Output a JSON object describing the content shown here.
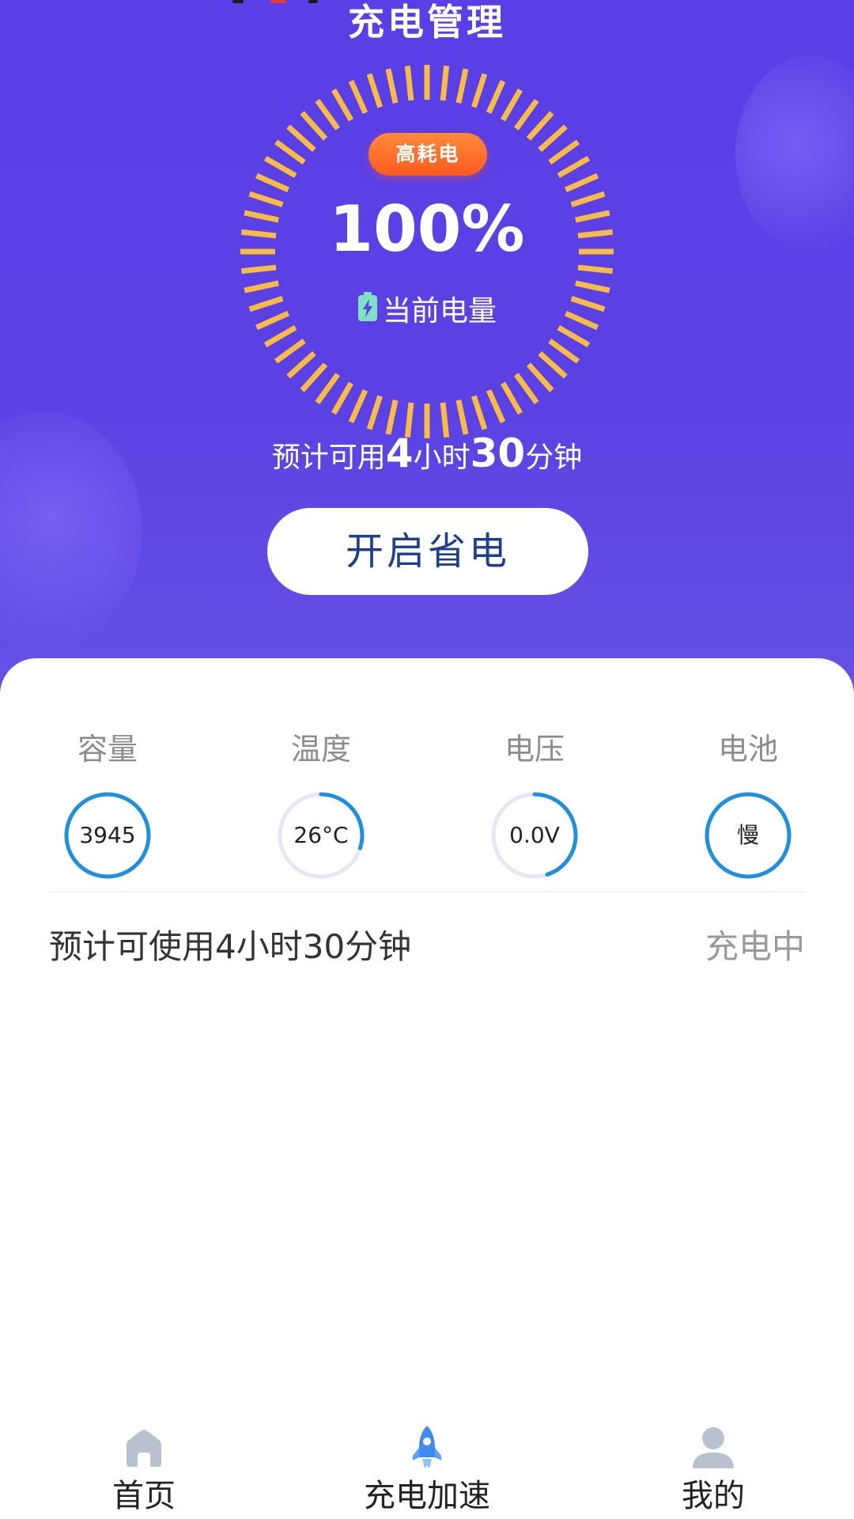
{
  "header": {
    "title": "充电管理"
  },
  "gauge": {
    "badge": "高耗电",
    "percent": "100%",
    "current_label": "当前电量",
    "level_fraction": 1.0
  },
  "estimate": {
    "prefix": "预计可用",
    "hours": "4",
    "hours_unit": "小时",
    "minutes": "30",
    "minutes_unit": "分钟"
  },
  "save_button": {
    "label": "开启省电"
  },
  "stats": [
    {
      "label": "容量",
      "value": "3945",
      "progress": 1.0
    },
    {
      "label": "温度",
      "value": "26°C",
      "progress": 0.3
    },
    {
      "label": "电压",
      "value": "0.0V",
      "progress": 0.45
    },
    {
      "label": "电池",
      "value": "慢",
      "progress": 1.0
    }
  ],
  "usage": {
    "text": "预计可使用4小时30分钟",
    "status": "充电中"
  },
  "nav": {
    "items": [
      {
        "label": "首页",
        "icon": "home-icon"
      },
      {
        "label": "充电加速",
        "icon": "rocket-icon"
      },
      {
        "label": "我的",
        "icon": "user-icon"
      }
    ]
  },
  "colors": {
    "hero_start": "#5a3ee6",
    "hero_end": "#6552e4",
    "tick": "#f8bb44",
    "badge": "#ff5a1e",
    "button_text": "#1d3f8f",
    "ring_active": "#1e90e0",
    "ring_track": "#e8e6f6",
    "nav_icon_gray": "#b8c2cf",
    "nav_icon_active": "#3f8cf0"
  }
}
